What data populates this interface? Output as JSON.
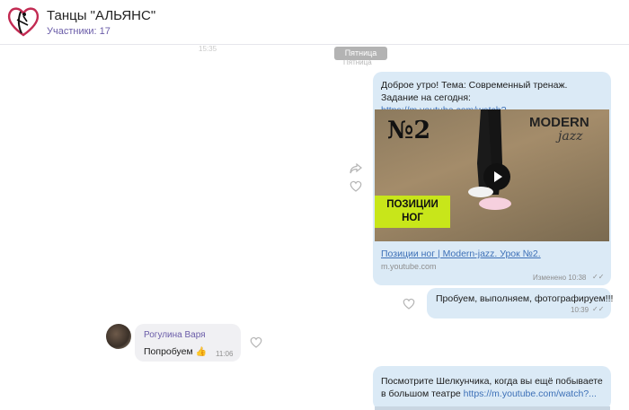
{
  "header": {
    "title": "Танцы \"АЛЬЯНС\"",
    "subtitle": "Участники: 17"
  },
  "timeline": {
    "faded_time": "15:35",
    "day_label": "Пятница",
    "day_label_shadow": "Пятница"
  },
  "messages": [
    {
      "text": "Доброе утро! Тема: Современный тренаж. Задание на сегодня: ",
      "link": "https://m.youtube.com/watch?...",
      "preview": {
        "overlay_number": "№2",
        "overlay_modern": "MODERN",
        "overlay_jazz": "jazz",
        "overlay_positions_line1": "ПОЗИЦИИ",
        "overlay_positions_line2": "НОГ",
        "title": "Позиции ног | Modern-jazz. Урок №2.",
        "domain": "m.youtube.com"
      },
      "meta": "Изменено 10:38",
      "ticks": "✓✓"
    },
    {
      "text": "Пробуем, выполняем, фотографируем!!!",
      "meta": "10:39",
      "ticks": "✓✓"
    },
    {
      "sender": "Рогулина Варя",
      "text": "Попробуем ",
      "emoji": "👍",
      "meta": "11:06"
    },
    {
      "text": "Посмотрите Шелкунчика, когда вы ещё побываете в большом театре ",
      "link": "https://m.youtube.com/watch?..."
    }
  ],
  "icons": {
    "share": "share-icon",
    "like": "heart-icon"
  },
  "colors": {
    "accent": "#6a5ca8",
    "outgoing_bubble": "#dbeaf6",
    "incoming_bubble": "#f0f0f3",
    "link": "#3d70b7",
    "logo": "#c22a52"
  }
}
